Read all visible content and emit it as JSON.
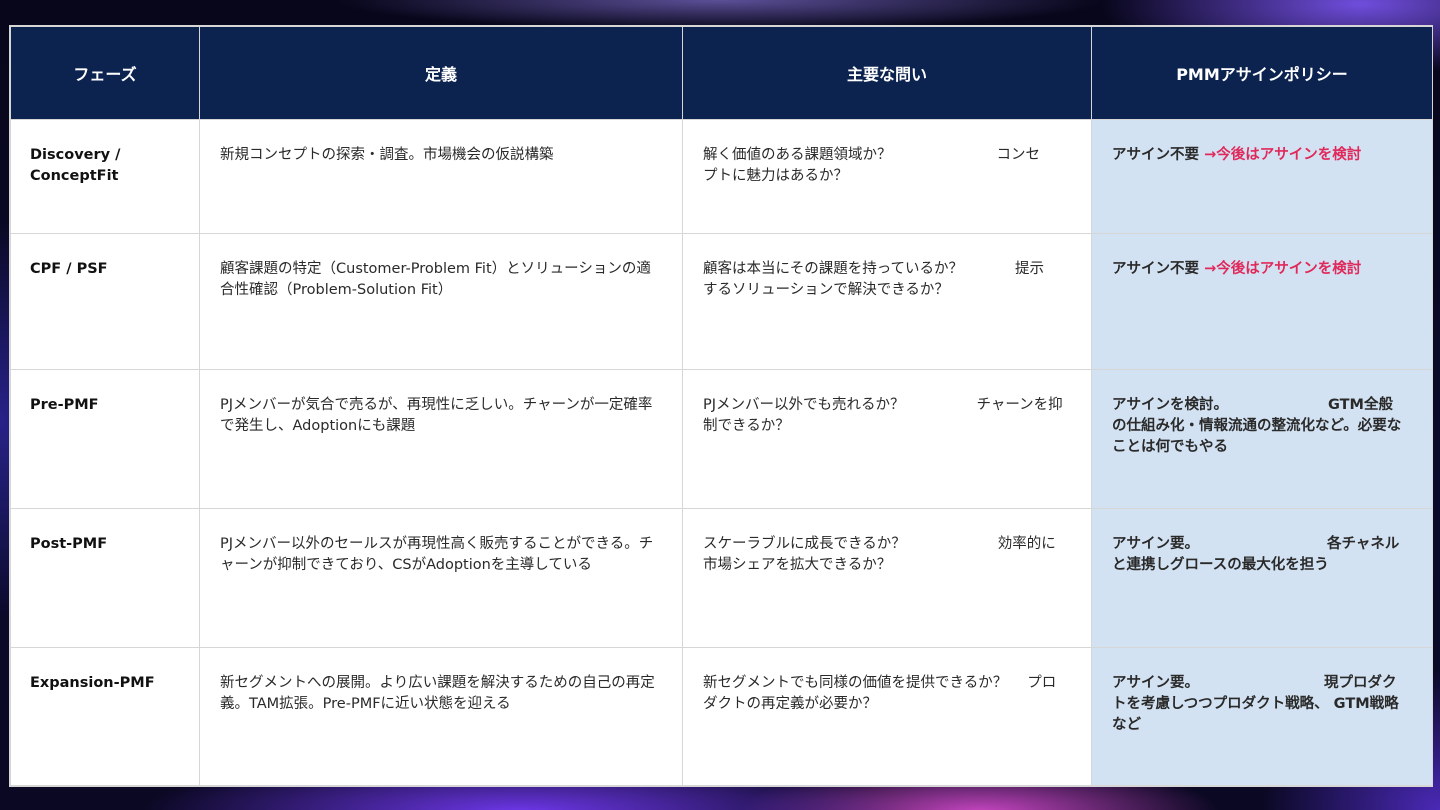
{
  "headers": [
    "フェーズ",
    "定義",
    "主要な問い",
    "PMMアサインポリシー"
  ],
  "colors": {
    "header_bg": "#0c2350",
    "policy_bg": "#d3e2f2",
    "accent": "#e0295a"
  },
  "rows": [
    {
      "phase": "Discovery / ConceptFit",
      "definition": "新規コンセプトの探索・調査。市場機会の仮説構築",
      "questions": [
        "解く価値のある課題領域か？",
        "コンセプトに魅力はあるか？"
      ],
      "policy": "アサイン不要",
      "policy_accent": "→今後はアサインを検討"
    },
    {
      "phase": "CPF / PSF",
      "definition": "顧客課題の特定（Customer-Problem Fit）とソリューションの適合性確認（Problem-Solution Fit）",
      "questions": [
        "顧客は本当にその課題を持っているか？",
        "提示するソリューションで解決できるか？"
      ],
      "policy": "アサイン不要",
      "policy_accent": "→今後はアサインを検討"
    },
    {
      "phase": "Pre-PMF",
      "definition": "PJメンバーが気合で売るが、再現性に乏しい。チャーンが一定確率で発生し、Adoptionにも課題",
      "questions": [
        "PJメンバー以外でも売れるか？",
        "チャーンを抑制できるか？"
      ],
      "policy": "アサインを検討。",
      "policy_detail": "GTM全般の仕組み化・情報流通の整流化など。必要なことは何でもやる"
    },
    {
      "phase": "Post-PMF",
      "definition": "PJメンバー以外のセールスが再現性高く販売することができる。チャーンが抑制できており、CSがAdoptionを主導している",
      "questions": [
        "スケーラブルに成長できるか？",
        "効率的に市場シェアを拡大できるか？"
      ],
      "policy": "アサイン要。",
      "policy_detail": "各チャネルと連携しグロースの最大化を担う"
    },
    {
      "phase": "Expansion-PMF",
      "definition": "新セグメントへの展開。より広い課題を解決するための自己の再定義。TAM拡張。Pre-PMFに近い状態を迎える",
      "questions": [
        "新セグメントでも同様の価値を提供できるか？",
        "プロダクトの再定義が必要か？"
      ],
      "policy": "アサイン要。",
      "policy_detail": "現プロダクトを考慮しつつプロダクト戦略、 GTM戦略など"
    }
  ]
}
